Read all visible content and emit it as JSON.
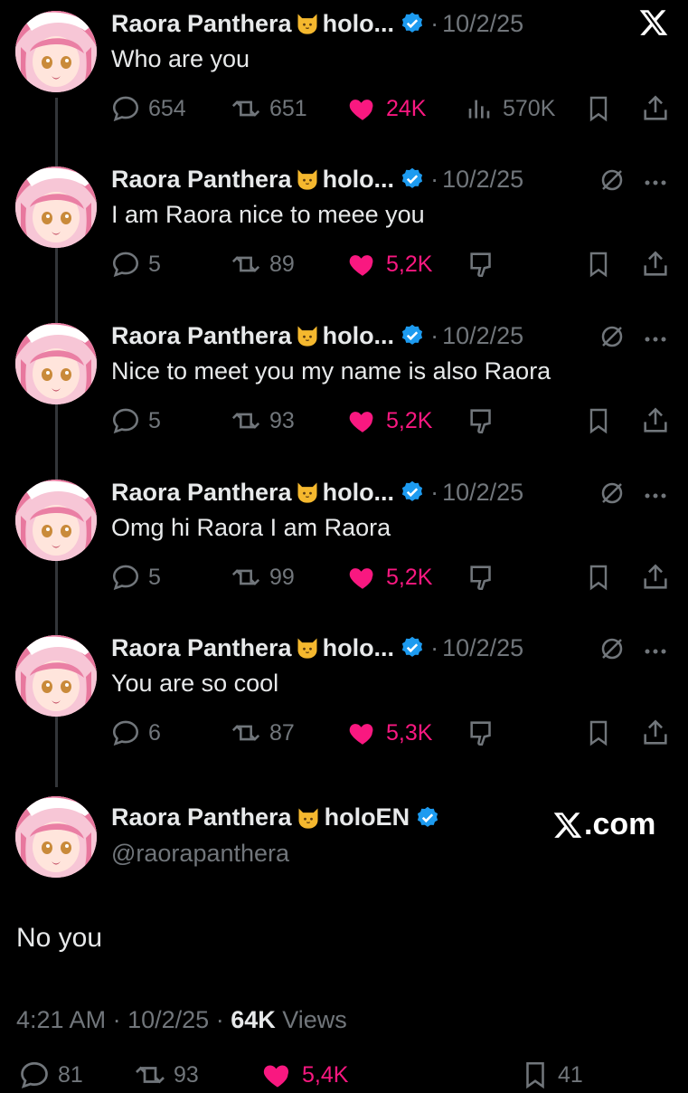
{
  "top_close_icon": "x-logo-icon",
  "tweets": [
    {
      "name": "Raora Panthera",
      "handle_short": "holo...",
      "date": "10/2/25",
      "text": "Who are you",
      "replies": "654",
      "reposts": "651",
      "likes": "24K",
      "views": "570K",
      "variant": "first"
    },
    {
      "name": "Raora Panthera",
      "handle_short": "holo...",
      "date": "10/2/25",
      "text": "I am Raora nice to meee you",
      "replies": "5",
      "reposts": "89",
      "likes": "5,2K",
      "variant": "reply"
    },
    {
      "name": "Raora Panthera",
      "handle_short": "holo...",
      "date": "10/2/25",
      "text": "Nice to meet you my name is also Raora",
      "replies": "5",
      "reposts": "93",
      "likes": "5,2K",
      "variant": "reply"
    },
    {
      "name": "Raora Panthera",
      "handle_short": "holo...",
      "date": "10/2/25",
      "text": "Omg hi Raora I am Raora",
      "replies": "5",
      "reposts": "99",
      "likes": "5,2K",
      "variant": "reply"
    },
    {
      "name": "Raora Panthera",
      "handle_short": "holo...",
      "date": "10/2/25",
      "text": "You are so cool",
      "replies": "6",
      "reposts": "87",
      "likes": "5,3K",
      "variant": "reply"
    }
  ],
  "main": {
    "name": "Raora Panthera",
    "org": "holoEN",
    "handle": "@raorapanthera",
    "brand": ".com",
    "text": "No you",
    "time": "4:21 AM",
    "date": "10/2/25",
    "views_count": "64K",
    "views_label": "Views",
    "replies": "81",
    "reposts": "93",
    "likes": "5,4K",
    "bookmarks": "41"
  },
  "colors": {
    "accent_like": "#f91880",
    "verified": "#1d9bf0",
    "muted": "#71767b"
  }
}
